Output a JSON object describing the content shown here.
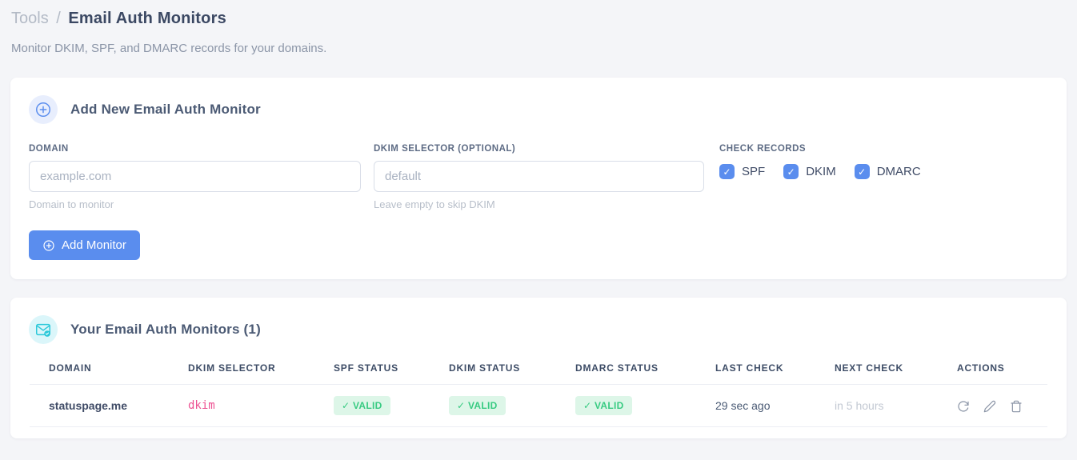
{
  "page": {
    "breadcrumb": {
      "section": "Tools",
      "separator": "/",
      "current": "Email Auth Monitors"
    },
    "subtitle": "Monitor DKIM, SPF, and DMARC records for your domains."
  },
  "icons": {
    "check_glyph": "✓",
    "add_circle": "plus-circle",
    "mail_check": "mail-with-check-badge"
  },
  "add_monitor_card": {
    "title": "Add New Email Auth Monitor",
    "fields": {
      "domain": {
        "label": "DOMAIN",
        "value": "",
        "placeholder": "example.com",
        "hint": "Domain to monitor"
      },
      "dkim_selector": {
        "label": "DKIM SELECTOR (OPTIONAL)",
        "value": "",
        "placeholder": "default",
        "hint": "Leave empty to skip DKIM"
      }
    },
    "check_records": {
      "label": "CHECK RECORDS",
      "options": [
        {
          "label": "SPF",
          "checked": true
        },
        {
          "label": "DKIM",
          "checked": true
        },
        {
          "label": "DMARC",
          "checked": true
        }
      ]
    },
    "submit_label": "Add Monitor"
  },
  "monitors_card": {
    "title": "Your Email Auth Monitors (1)",
    "count": 1,
    "table": {
      "columns": [
        "DOMAIN",
        "DKIM SELECTOR",
        "SPF STATUS",
        "DKIM STATUS",
        "DMARC STATUS",
        "LAST CHECK",
        "NEXT CHECK",
        "ACTIONS"
      ],
      "rows": [
        {
          "domain": "statuspage.me",
          "dkim_selector": "dkim",
          "spf_status": "VALID",
          "dkim_status": "VALID",
          "dmarc_status": "VALID",
          "last_check": "29 sec ago",
          "next_check": "in 5 hours"
        }
      ]
    }
  },
  "colors": {
    "accent_blue": "#5a8dee",
    "accent_cyan": "#2bc8d9",
    "valid_green_text": "#38cb82",
    "valid_green_bg": "#ddf6e8",
    "selector_pink": "#ed5393",
    "page_bg": "#f4f5f8"
  }
}
